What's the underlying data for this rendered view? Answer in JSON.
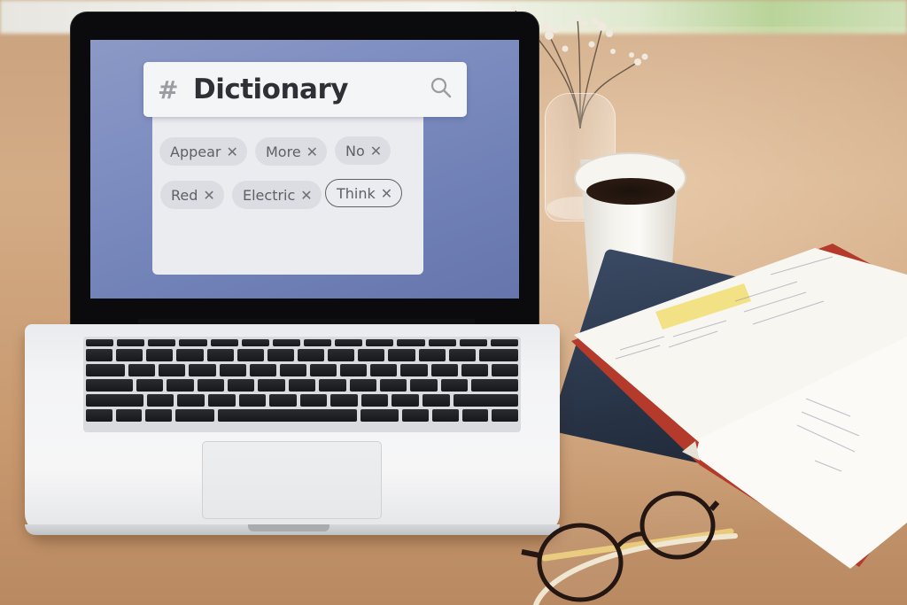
{
  "scene": {
    "description": "Laptop on wooden desk displaying a dictionary tag-search UI, with coffee cup, flower vase, notebooks and glasses"
  },
  "dictionary_app": {
    "hash_symbol": "#",
    "title": "Dictionary",
    "search_icon": "search-icon",
    "tags": [
      {
        "label": "Appear",
        "remove_glyph": "✕",
        "selected": false
      },
      {
        "label": "More",
        "remove_glyph": "✕",
        "selected": false
      },
      {
        "label": "No",
        "remove_glyph": "✕",
        "selected": false
      },
      {
        "label": "Red",
        "remove_glyph": "✕",
        "selected": false
      },
      {
        "label": "Electric",
        "remove_glyph": "✕",
        "selected": false
      },
      {
        "label": "Think",
        "remove_glyph": "✕",
        "selected": true
      }
    ]
  },
  "colors": {
    "screen_background": "#7d8dc0",
    "search_bar": "#f4f5f7",
    "panel": "#ebecef",
    "tag_fill": "#dcdde2",
    "title_text": "#2f3035",
    "selected_tag_border": "#5f6168"
  }
}
